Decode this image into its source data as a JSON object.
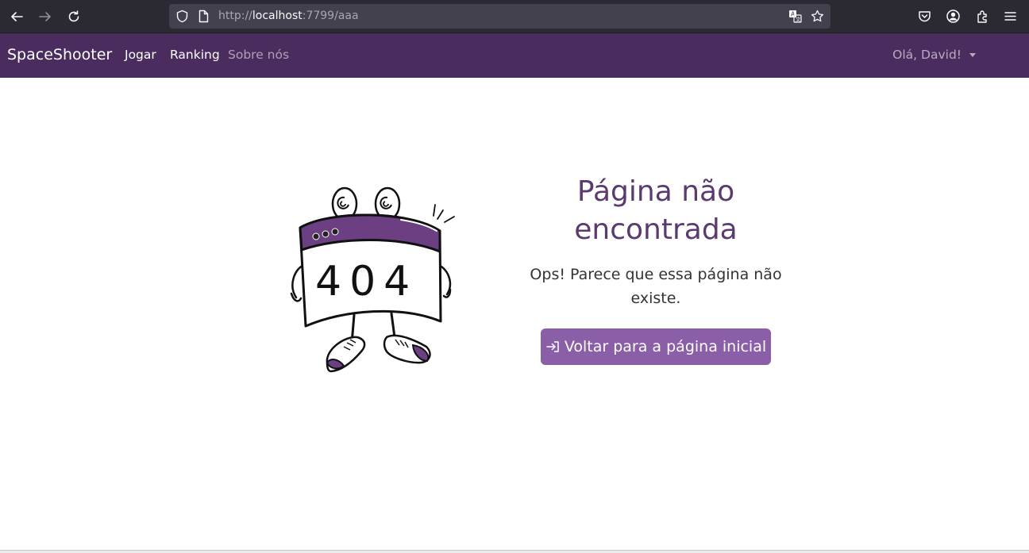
{
  "browser": {
    "url_scheme": "http://",
    "url_host": "localhost",
    "url_rest": ":7799/aaa"
  },
  "navbar": {
    "brand": "SpaceShooter",
    "links": [
      {
        "label": "Jogar"
      },
      {
        "label": "Ranking"
      },
      {
        "label": "Sobre nós"
      }
    ],
    "user_greeting": "Olá, David!"
  },
  "main": {
    "illustration_text": "404",
    "title": "Página não encontrada",
    "subtitle": "Ops! Parece que essa página não existe.",
    "home_button_label": "Voltar para a página inicial"
  },
  "colors": {
    "navbar_bg": "#4b2c5e",
    "title": "#5b3a70",
    "button_bg": "#8a5fa8"
  }
}
